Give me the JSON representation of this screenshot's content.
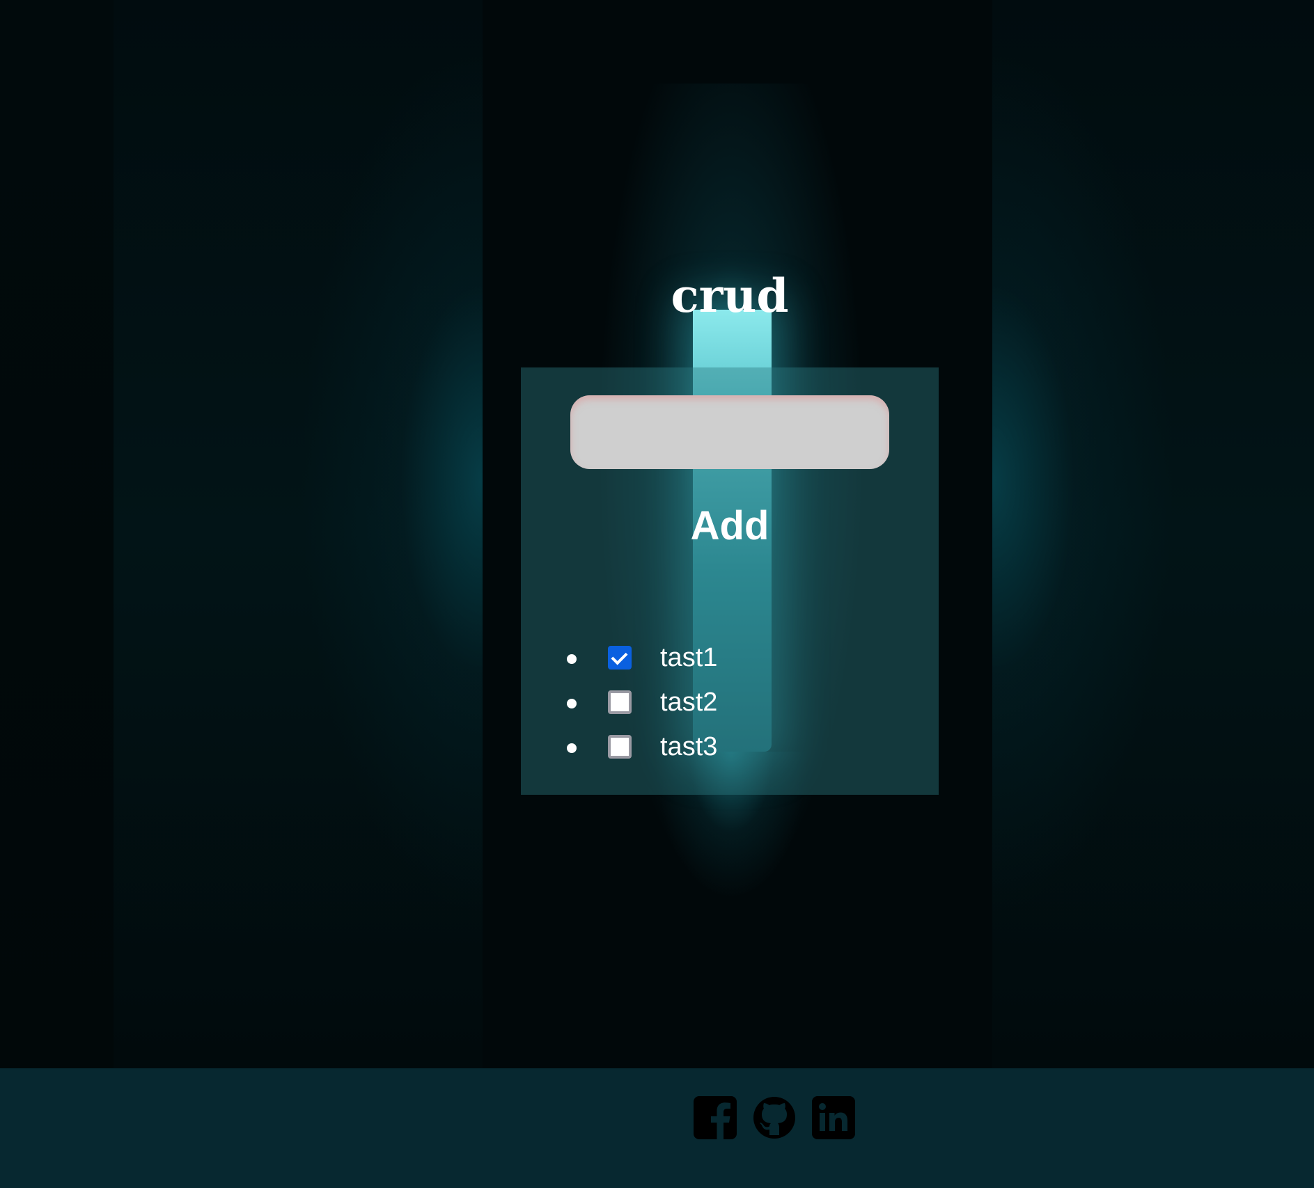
{
  "page": {
    "title": "crud"
  },
  "form": {
    "input_value": "",
    "input_placeholder": "",
    "add_label": "Add"
  },
  "tasks": [
    {
      "label": "tast1",
      "checked": true
    },
    {
      "label": "tast2",
      "checked": false
    },
    {
      "label": "tast3",
      "checked": false
    }
  ],
  "footer": {
    "icons": [
      "facebook-icon",
      "github-icon",
      "linkedin-icon"
    ]
  },
  "colors": {
    "footer_bg": "#072830",
    "beam": "#8ce9ec",
    "checkbox_checked": "#0a60e0",
    "input_bg": "#cfcfcf"
  }
}
